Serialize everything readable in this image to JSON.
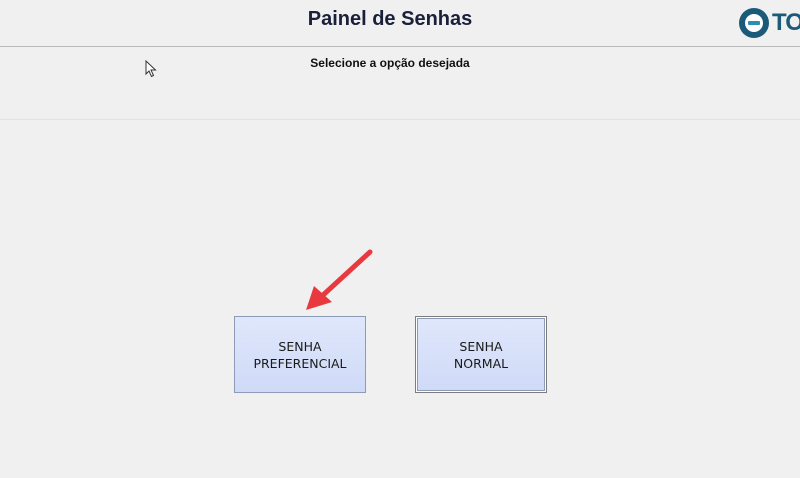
{
  "header": {
    "title": "Painel de Senhas",
    "logo_text": "TO"
  },
  "main": {
    "instruction": "Selecione a opção desejada",
    "buttons": [
      {
        "line1": "SENHA",
        "line2": "PREFERENCIAL"
      },
      {
        "line1": "SENHA",
        "line2": "NORMAL"
      }
    ]
  },
  "colors": {
    "accent_arrow": "#e8393f",
    "button_fill": "#d6e0f9",
    "logo": "#1c5a7a"
  },
  "icons": {
    "logo": "totvs-logo-icon",
    "cursor": "mouse-pointer-icon",
    "annotation": "red-arrow-icon"
  }
}
